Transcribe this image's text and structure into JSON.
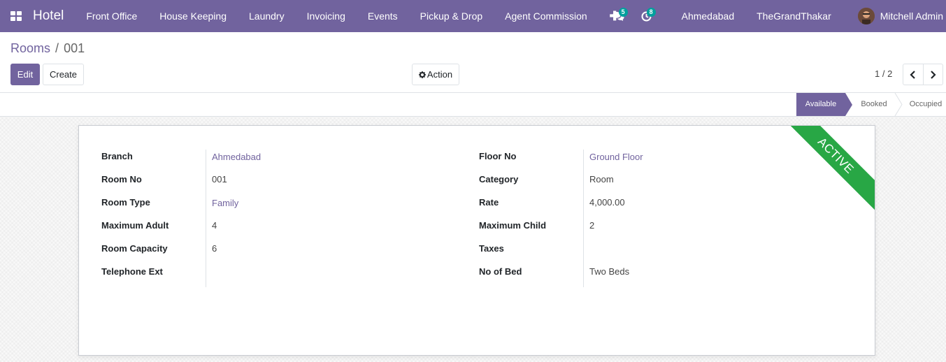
{
  "navbar": {
    "brand": "Hotel",
    "menu": [
      "Front Office",
      "House Keeping",
      "Laundry",
      "Invoicing",
      "Events",
      "Pickup & Drop",
      "Agent Commission"
    ],
    "plus": "✚",
    "messages_count": "5",
    "activities_count": "8",
    "branch": "Ahmedabad",
    "company": "TheGrandThakar",
    "user": "Mitchell Admin"
  },
  "breadcrumb": {
    "parent": "Rooms",
    "separator": "/",
    "current": "001"
  },
  "buttons": {
    "edit": "Edit",
    "create": "Create",
    "action": "Action"
  },
  "pager": {
    "value": "1 / 2"
  },
  "statusbar": {
    "stages": [
      "Available",
      "Booked",
      "Occupied"
    ],
    "active": "Available"
  },
  "ribbon": "ACTIVE",
  "form": {
    "left": [
      {
        "label": "Branch",
        "value": "Ahmedabad",
        "link": true
      },
      {
        "label": "Room No",
        "value": "001",
        "link": false
      },
      {
        "label": "Room Type",
        "value": "Family",
        "link": true
      },
      {
        "label": "Maximum Adult",
        "value": "4",
        "link": false
      },
      {
        "label": "Room Capacity",
        "value": "6",
        "link": false
      },
      {
        "label": "Telephone Ext",
        "value": "",
        "link": false
      }
    ],
    "right": [
      {
        "label": "Floor No",
        "value": "Ground Floor",
        "link": true
      },
      {
        "label": "Category",
        "value": "Room",
        "link": false
      },
      {
        "label": "Rate",
        "value": "4,000.00",
        "link": false
      },
      {
        "label": "Maximum Child",
        "value": "2",
        "link": false
      },
      {
        "label": "Taxes",
        "value": "",
        "link": false
      },
      {
        "label": "No of Bed",
        "value": "Two Beds",
        "link": false
      }
    ]
  },
  "colors": {
    "primary": "#71639e",
    "ribbon": "#28a745",
    "badge": "#00a09d"
  }
}
